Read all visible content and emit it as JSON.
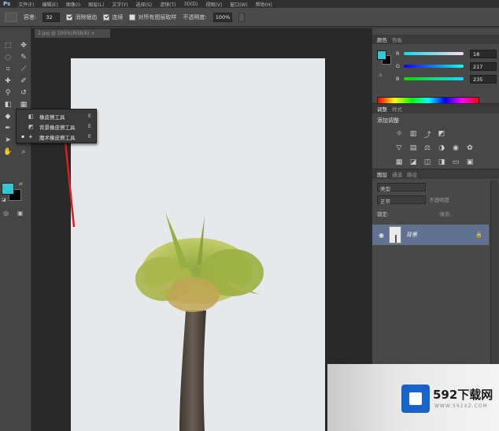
{
  "menubar": {
    "logo": "Ps",
    "items": [
      "文件(F)",
      "编辑(E)",
      "图像(I)",
      "图层(L)",
      "文字(Y)",
      "选择(S)",
      "滤镜(T)",
      "3D(D)",
      "视图(V)",
      "窗口(W)",
      "帮助(H)"
    ]
  },
  "options": {
    "tolerance_label": "容差:",
    "tolerance_value": "32",
    "antialias_label": "消除锯齿",
    "contiguous_label": "连续",
    "sample_all_label": "对所有图层取样",
    "opacity_label": "不透明度:",
    "opacity_value": "100%"
  },
  "document": {
    "tab_title": "2.jpg @ 100%(RGB/8)",
    "tab_close": "×"
  },
  "flyout": {
    "items": [
      {
        "label": "橡皮擦工具",
        "shortcut": "E",
        "selected": ""
      },
      {
        "label": "背景橡皮擦工具",
        "shortcut": "E",
        "selected": ""
      },
      {
        "label": "魔术橡皮擦工具",
        "shortcut": "E",
        "selected": "▪"
      }
    ]
  },
  "color_panel": {
    "tabs": [
      "颜色",
      "色板"
    ],
    "channels": [
      {
        "name": "R",
        "value": "18"
      },
      {
        "name": "G",
        "value": "217"
      },
      {
        "name": "B",
        "value": "235"
      }
    ],
    "foreground": "#31c7d6",
    "background": "#050505"
  },
  "adjust_panel": {
    "tabs": [
      "调整",
      "样式"
    ],
    "title": "添加调整"
  },
  "layers_panel": {
    "tabs": [
      "图层",
      "通道",
      "路径"
    ],
    "kind_label": "类型",
    "blend_mode": "正常",
    "opacity_label": "不透明度",
    "lock_label": "锁定:",
    "fill_label": "填充:",
    "layers": [
      {
        "name": "背景",
        "visible_icon": "◉",
        "lock_icon": "🔒"
      }
    ]
  },
  "watermark": {
    "brand": "592下载网",
    "url": "WWW.592XZ.COM"
  }
}
